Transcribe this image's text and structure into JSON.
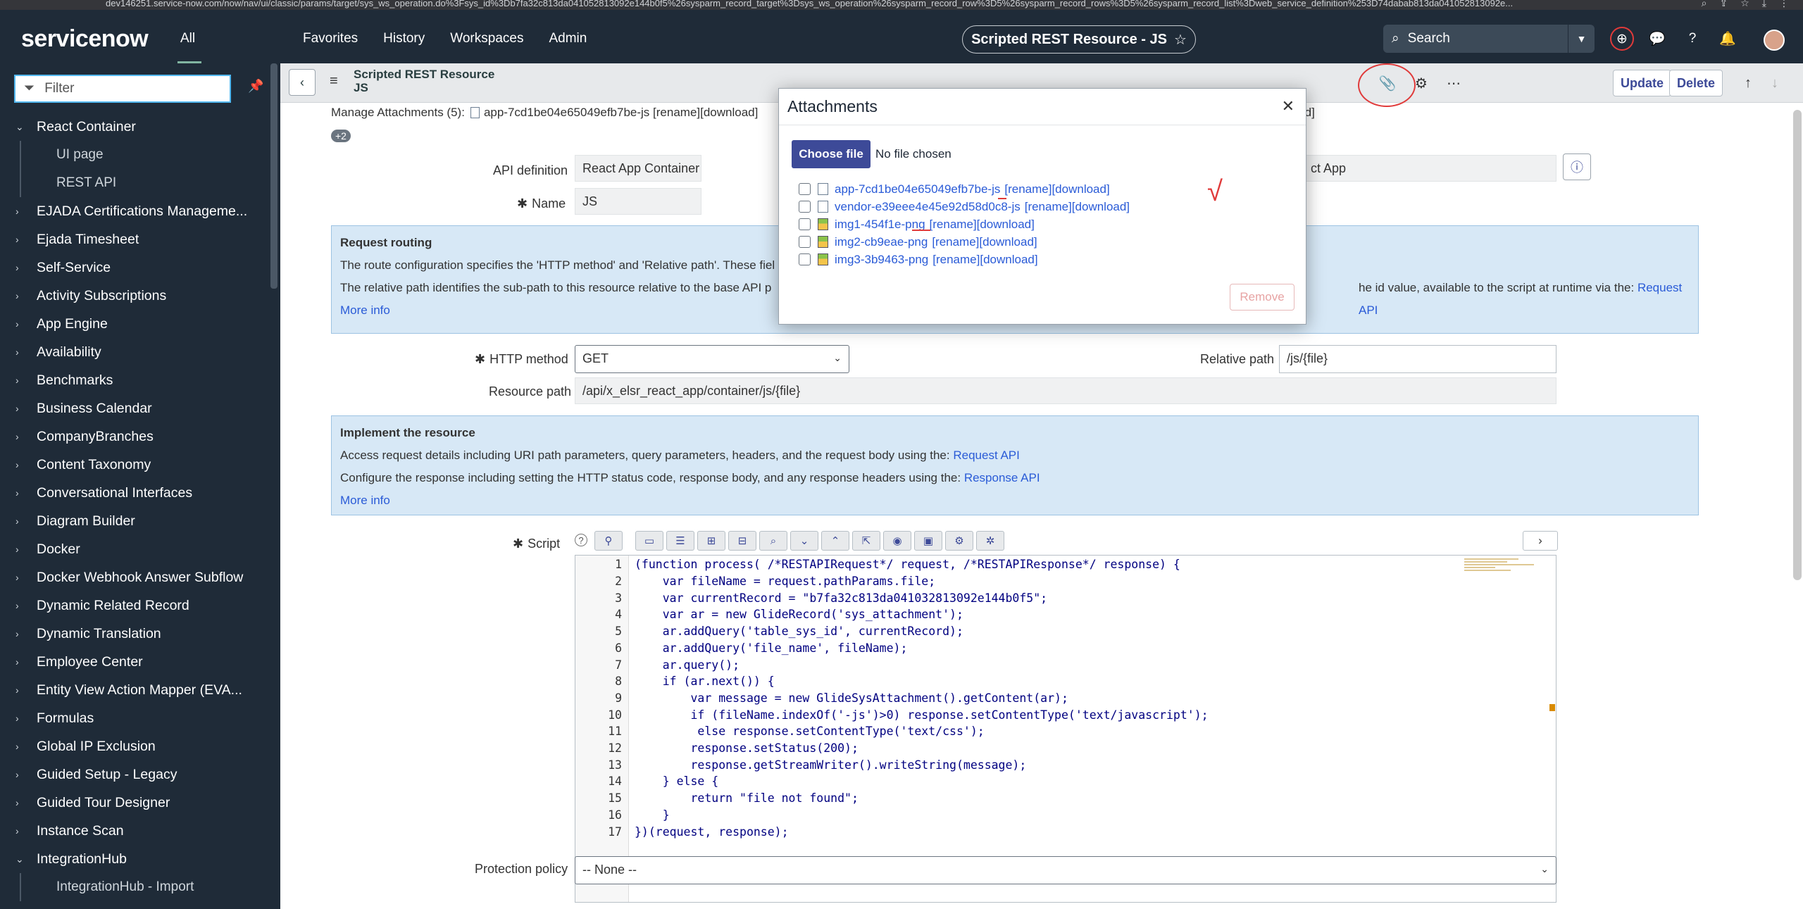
{
  "browser": {
    "url": "dev146251.service-now.com/now/nav/ui/classic/params/target/sys_ws_operation.do%3Fsys_id%3Db7fa32c813da041052813092e144b0f5%26sysparm_record_target%3Dsys_ws_operation%26sysparm_record_row%3D5%26sysparm_record_rows%3D5%26sysparm_record_list%3Dweb_service_definition%253D74dabab813da041052813092e..."
  },
  "topnav": {
    "logo": "servicenow",
    "all_label": "All",
    "menu": [
      "Favorites",
      "History",
      "Workspaces",
      "Admin"
    ],
    "record_title": "Scripted REST Resource - JS",
    "search_placeholder": "Search"
  },
  "sidebar": {
    "filter_placeholder": "Filter",
    "items": [
      {
        "label": "React Container",
        "expanded": true,
        "children": [
          "UI page",
          "REST API"
        ]
      },
      {
        "label": "EJADA Certifications Manageme..."
      },
      {
        "label": "Ejada Timesheet"
      },
      {
        "label": "Self-Service"
      },
      {
        "label": "Activity Subscriptions"
      },
      {
        "label": "App Engine"
      },
      {
        "label": "Availability"
      },
      {
        "label": "Benchmarks"
      },
      {
        "label": "Business Calendar"
      },
      {
        "label": "CompanyBranches"
      },
      {
        "label": "Content Taxonomy"
      },
      {
        "label": "Conversational Interfaces"
      },
      {
        "label": "Diagram Builder"
      },
      {
        "label": "Docker"
      },
      {
        "label": "Docker Webhook Answer Subflow"
      },
      {
        "label": "Dynamic Related Record"
      },
      {
        "label": "Dynamic Translation"
      },
      {
        "label": "Employee Center"
      },
      {
        "label": "Entity View Action Mapper (EVA..."
      },
      {
        "label": "Formulas"
      },
      {
        "label": "Global IP Exclusion"
      },
      {
        "label": "Guided Setup - Legacy"
      },
      {
        "label": "Guided Tour Designer"
      },
      {
        "label": "Instance Scan"
      },
      {
        "label": "IntegrationHub",
        "expanded": true,
        "children": [
          "IntegrationHub - Import"
        ]
      }
    ]
  },
  "form": {
    "header_title_line1": "Scripted REST Resource",
    "header_title_line2": "JS",
    "update_label": "Update",
    "delete_label": "Delete",
    "manage_attachments_label": "Manage Attachments (5):",
    "manage_first_file": "app-7cd1be04e65049efb7be-js [rename][download]",
    "manage_tail": "load]",
    "more_count": "+2",
    "api_definition_label": "API definition",
    "api_definition_value": "React App Container",
    "api_definition_right_value": "ct App",
    "name_label": "Name",
    "name_value": "JS",
    "routing": {
      "heading": "Request routing",
      "line1": "The route configuration specifies the 'HTTP method' and 'Relative path'. These fiel",
      "line2_start": "The relative path identifies the sub-path to this resource relative to the base API p",
      "line2_end": "he id value, available to the script at runtime via the:",
      "line2_link": "Request API",
      "more_info": "More info"
    },
    "http_method_label": "HTTP method",
    "http_method_value": "GET",
    "relative_path_label": "Relative path",
    "relative_path_value": "/js/{file}",
    "resource_path_label": "Resource path",
    "resource_path_value": "/api/x_elsr_react_app/container/js/{file}",
    "implement": {
      "heading": "Implement the resource",
      "line1": "Access request details including URI path parameters, query parameters, headers, and the request body using the:",
      "line1_link": "Request API",
      "line2": "Configure the response including setting the HTTP status code, response body, and any response headers using the:",
      "line2_link": "Response API",
      "more_info": "More info"
    },
    "script_label": "Script",
    "protection_policy_label": "Protection policy",
    "protection_policy_value": "-- None --"
  },
  "script_lines": [
    "(function process( /*RESTAPIRequest*/ request, /*RESTAPIResponse*/ response) {",
    "    var fileName = request.pathParams.file;",
    "    var currentRecord = \"b7fa32c813da041032813092e144b0f5\";",
    "    var ar = new GlideRecord('sys_attachment');",
    "    ar.addQuery('table_sys_id', currentRecord);",
    "    ar.addQuery('file_name', fileName);",
    "    ar.query();",
    "    if (ar.next()) {",
    "        var message = new GlideSysAttachment().getContent(ar);",
    "        if (fileName.indexOf('-js')>0) response.setContentType('text/javascript');",
    "         else response.setContentType('text/css');",
    "        response.setStatus(200);",
    "        response.getStreamWriter().writeString(message);",
    "    } else {",
    "        return \"file not found\";",
    "    }",
    "})(request, response);"
  ],
  "modal": {
    "title": "Attachments",
    "choose_file": "Choose file",
    "no_file": "No file chosen",
    "remove_label": "Remove",
    "attachments": [
      {
        "name": "app-7cd1be04e65049efb7be-js",
        "type": "file",
        "actions": "[rename][download]"
      },
      {
        "name": "vendor-e39eee4e45e92d58d0c8-js",
        "type": "file",
        "actions": "[rename][download]"
      },
      {
        "name": "img1-454f1e-png",
        "type": "image",
        "actions": "[rename][download]"
      },
      {
        "name": "img2-cb9eae-png",
        "type": "image",
        "actions": "[rename][download]"
      },
      {
        "name": "img3-3b9463-png",
        "type": "image",
        "actions": "[rename][download]"
      }
    ]
  },
  "annotation": {
    "checkmark": "√"
  },
  "colors": {
    "nav_bg": "#1f2b38",
    "accent": "#3d4a98",
    "link": "#2a5bd7",
    "info_bg": "#d7e8f6",
    "annotation_red": "#e03a3a"
  }
}
